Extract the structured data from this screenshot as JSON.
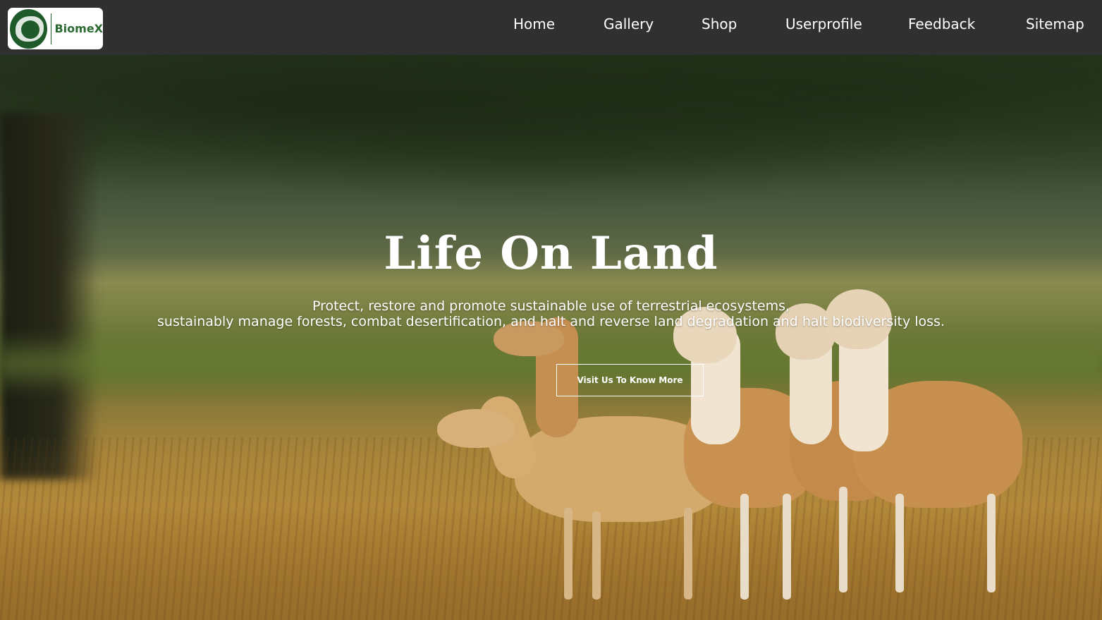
{
  "brand": {
    "logo_text": "BiomeX",
    "logo_icon": "lion-emblem-icon",
    "primary_color": "#1f5a2a"
  },
  "nav": {
    "items": [
      {
        "label": "Home"
      },
      {
        "label": "Gallery"
      },
      {
        "label": "Shop"
      },
      {
        "label": "Userprofile"
      },
      {
        "label": "Feedback"
      },
      {
        "label": "Sitemap"
      }
    ]
  },
  "hero": {
    "title": "Life On Land",
    "subtitle_line1": "Protect, restore and promote sustainable use of terrestrial ecosystems,",
    "subtitle_line2": "sustainably manage forests, combat desertification, and halt and reverse land degradation and halt biodiversity loss.",
    "cta_label": "Visit Us To Know More"
  }
}
